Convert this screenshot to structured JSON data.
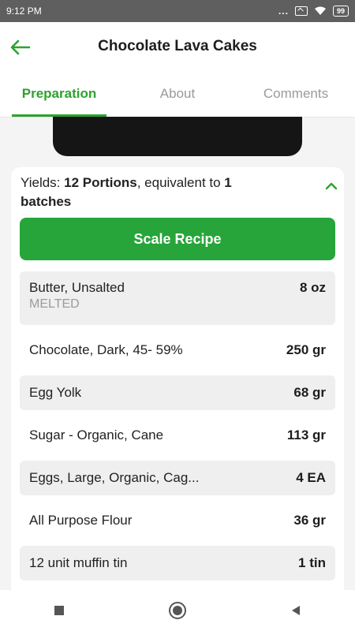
{
  "status_bar": {
    "time": "9:12 PM",
    "dots": "...",
    "battery": "99"
  },
  "header": {
    "title": "Chocolate Lava Cakes",
    "back_icon": "arrow-left-icon",
    "accent_color": "#2ea22e"
  },
  "tabs": [
    {
      "label": "Preparation",
      "active": true
    },
    {
      "label": "About",
      "active": false
    },
    {
      "label": "Comments",
      "active": false
    }
  ],
  "yields": {
    "prefix": "Yields: ",
    "portions": "12 Portions",
    "middle": ", equivalent to ",
    "batches_count": "1",
    "suffix": "batches"
  },
  "scale_button": {
    "label": "Scale Recipe",
    "color": "#27a53a"
  },
  "ingredients": [
    {
      "name": "Butter,  Unsalted",
      "note": "MELTED",
      "qty": "8 oz"
    },
    {
      "name": "Chocolate, Dark, 45- 59%",
      "note": "",
      "qty": "250 gr"
    },
    {
      "name": "Egg Yolk",
      "note": "",
      "qty": "68 gr"
    },
    {
      "name": "Sugar - Organic, Cane",
      "note": "",
      "qty": "113 gr"
    },
    {
      "name": "Eggs, Large, Organic, Cag...",
      "note": "",
      "qty": "4 EA"
    },
    {
      "name": "All Purpose Flour",
      "note": "",
      "qty": "36 gr"
    },
    {
      "name": "12 unit muffin tin",
      "note": "",
      "qty": "1 tin"
    }
  ],
  "nav": [
    "stop-square-icon",
    "home-circle-icon",
    "back-triangle-icon"
  ]
}
